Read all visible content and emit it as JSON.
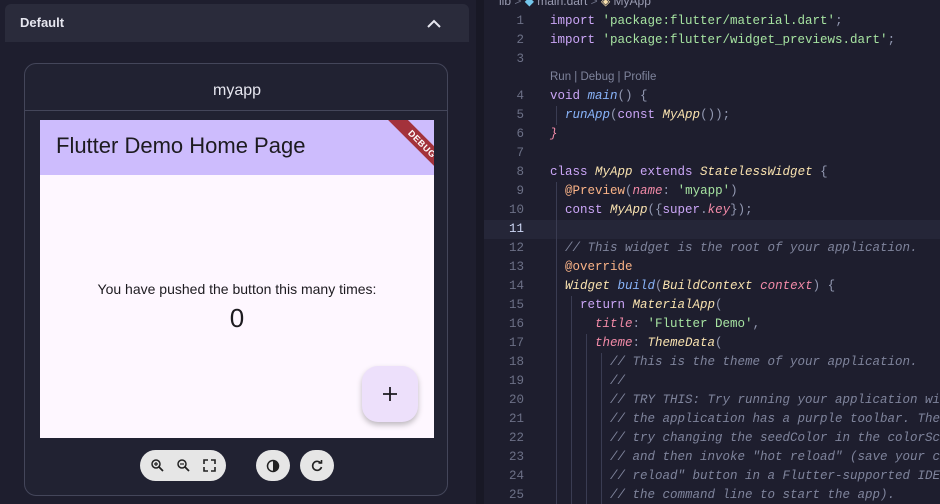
{
  "preview_panel": {
    "section_title": "Default",
    "card_title": "myapp",
    "app": {
      "appbar_title": "Flutter Demo Home Page",
      "debug_banner": "DEBUG",
      "message": "You have pushed the button this many times:",
      "counter": "0",
      "fab_icon": "plus-icon"
    },
    "toolbar": {
      "zoom_in_icon": "zoom-in-icon",
      "zoom_out_icon": "zoom-out-icon",
      "fit_icon": "fit-screen-icon",
      "theme_icon": "dark-mode-icon",
      "restart_icon": "restart-icon"
    }
  },
  "editor": {
    "breadcrumb": [
      "lib",
      "main.dart",
      "MyApp"
    ],
    "codelens": "Run | Debug | Profile",
    "current_line": 11,
    "lines": [
      {
        "n": "1",
        "tokens": [
          [
            "kw",
            "import "
          ],
          [
            "str",
            "'package:flutter/material.dart'"
          ],
          [
            "pn",
            ";"
          ]
        ]
      },
      {
        "n": "2",
        "tokens": [
          [
            "kw",
            "import "
          ],
          [
            "str",
            "'package:flutter/widget_previews.dart'"
          ],
          [
            "pn",
            ";"
          ]
        ]
      },
      {
        "n": "3",
        "tokens": []
      },
      {
        "n": "4",
        "tokens": [
          [
            "kw",
            "void "
          ],
          [
            "fn",
            "main"
          ],
          [
            "pn",
            "() {"
          ]
        ]
      },
      {
        "n": "5",
        "tokens": [
          [
            "fn",
            "  runApp"
          ],
          [
            "pn",
            "("
          ],
          [
            "kw",
            "const "
          ],
          [
            "cls",
            "MyApp"
          ],
          [
            "pn",
            "());"
          ]
        ]
      },
      {
        "n": "6",
        "tokens": [
          [
            "prm",
            "}"
          ]
        ]
      },
      {
        "n": "7",
        "tokens": []
      },
      {
        "n": "8",
        "tokens": [
          [
            "kw",
            "class "
          ],
          [
            "cls",
            "MyApp "
          ],
          [
            "kw",
            "extends "
          ],
          [
            "cls",
            "StatelessWidget "
          ],
          [
            "pn",
            "{"
          ]
        ]
      },
      {
        "n": "9",
        "tokens": [
          [
            "ann",
            "  @Preview"
          ],
          [
            "pn",
            "("
          ],
          [
            "prm",
            "name"
          ],
          [
            "pn",
            ": "
          ],
          [
            "str",
            "'myapp'"
          ],
          [
            "pn",
            ")"
          ]
        ]
      },
      {
        "n": "10",
        "tokens": [
          [
            "kw",
            "  const "
          ],
          [
            "cls",
            "MyApp"
          ],
          [
            "pn",
            "({"
          ],
          [
            "kw",
            "super"
          ],
          [
            "pn",
            "."
          ],
          [
            "prm",
            "key"
          ],
          [
            "pn",
            "});"
          ]
        ]
      },
      {
        "n": "11",
        "tokens": []
      },
      {
        "n": "12",
        "tokens": [
          [
            "cm",
            "  // This widget is the root of your application."
          ]
        ]
      },
      {
        "n": "13",
        "tokens": [
          [
            "ann",
            "  @override"
          ]
        ]
      },
      {
        "n": "14",
        "tokens": [
          [
            "cls",
            "  Widget "
          ],
          [
            "fn",
            "build"
          ],
          [
            "pn",
            "("
          ],
          [
            "cls",
            "BuildContext "
          ],
          [
            "prm",
            "context"
          ],
          [
            "pn",
            ") {"
          ]
        ]
      },
      {
        "n": "15",
        "tokens": [
          [
            "kw",
            "    return "
          ],
          [
            "cls",
            "MaterialApp"
          ],
          [
            "pn",
            "("
          ]
        ]
      },
      {
        "n": "16",
        "tokens": [
          [
            "prm",
            "      title"
          ],
          [
            "pn",
            ": "
          ],
          [
            "str",
            "'Flutter Demo'"
          ],
          [
            "pn",
            ","
          ]
        ]
      },
      {
        "n": "17",
        "tokens": [
          [
            "prm",
            "      theme"
          ],
          [
            "pn",
            ": "
          ],
          [
            "cls",
            "ThemeData"
          ],
          [
            "pn",
            "("
          ]
        ]
      },
      {
        "n": "18",
        "tokens": [
          [
            "cm",
            "        // This is the theme of your application."
          ]
        ]
      },
      {
        "n": "19",
        "tokens": [
          [
            "cm",
            "        //"
          ]
        ]
      },
      {
        "n": "20",
        "tokens": [
          [
            "cm",
            "        // TRY THIS: Try running your application wit"
          ]
        ]
      },
      {
        "n": "21",
        "tokens": [
          [
            "cm",
            "        // the application has a purple toolbar. Then"
          ]
        ]
      },
      {
        "n": "22",
        "tokens": [
          [
            "cm",
            "        // try changing the seedColor in the colorSch"
          ]
        ]
      },
      {
        "n": "23",
        "tokens": [
          [
            "cm",
            "        // and then invoke \"hot reload\" (save your ch"
          ]
        ]
      },
      {
        "n": "24",
        "tokens": [
          [
            "cm",
            "        // reload\" button in a Flutter-supported IDE,"
          ]
        ]
      },
      {
        "n": "25",
        "tokens": [
          [
            "cm",
            "        // the command line to start the app)."
          ]
        ]
      }
    ]
  },
  "colors": {
    "background": "#1e1e2e",
    "appbar": "#cdbcfd",
    "app_surface": "#fef7ff",
    "fab": "#ede0fb",
    "debug_banner": "#a3323b"
  }
}
